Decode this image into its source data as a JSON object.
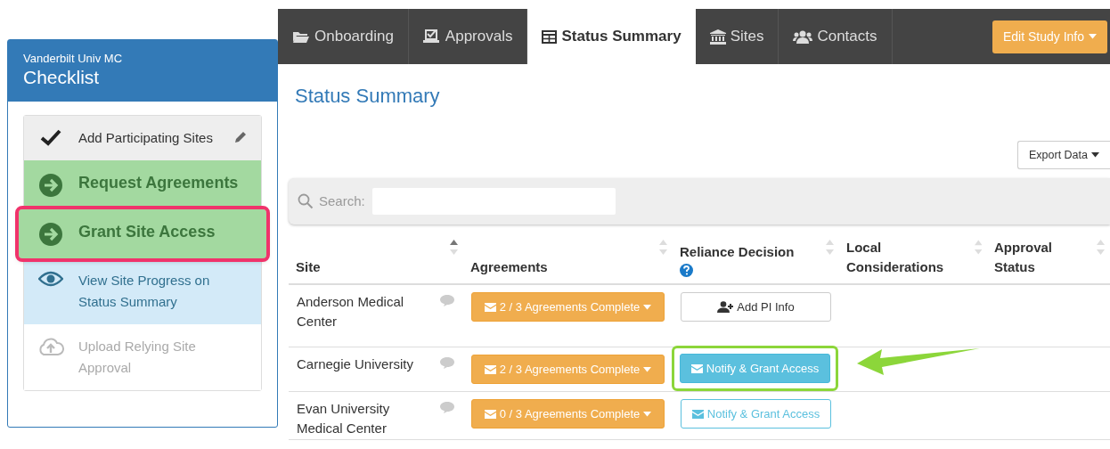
{
  "checklist": {
    "subtitle": "Vanderbilt Univ MC",
    "title": "Checklist",
    "items": [
      {
        "label": "Add Participating Sites",
        "kind": "done",
        "highlighted": false,
        "editable": true
      },
      {
        "label": "Request Agreements",
        "kind": "current",
        "highlighted": false,
        "editable": false
      },
      {
        "label": "Grant Site Access",
        "kind": "current",
        "highlighted": true,
        "editable": false
      },
      {
        "label": "View Site Progress on Status Summary",
        "kind": "view",
        "highlighted": false,
        "editable": false
      },
      {
        "label": "Upload Relying Site Approval",
        "kind": "pending",
        "highlighted": false,
        "editable": false
      }
    ]
  },
  "tabs": [
    {
      "label": "Onboarding",
      "selected": false
    },
    {
      "label": "Approvals",
      "selected": false
    },
    {
      "label": "Status Summary",
      "selected": true
    },
    {
      "label": "Sites",
      "selected": false
    },
    {
      "label": "Contacts",
      "selected": false
    }
  ],
  "edit_button": "Edit Study Info",
  "page_title": "Status Summary",
  "export_button": "Export Data",
  "search": {
    "label": "Search:"
  },
  "table": {
    "columns": [
      {
        "label": "Site",
        "sorted": true,
        "help": false
      },
      {
        "label": "Agreements",
        "sorted": false,
        "help": false
      },
      {
        "label": "Reliance Decision",
        "sorted": false,
        "help": true
      },
      {
        "label": "Local Considerations",
        "sorted": false,
        "help": false
      },
      {
        "label": "Approval Status",
        "sorted": false,
        "help": false
      }
    ],
    "rows": [
      {
        "site": "Anderson Medical Center",
        "agreements": "2 / 3 Agreements Complete",
        "action": {
          "kind": "add_pi",
          "label": "Add PI Info",
          "highlighted": false
        }
      },
      {
        "site": "Carnegie University",
        "agreements": "2 / 3 Agreements Complete",
        "action": {
          "kind": "notify_filled",
          "label": "Notify & Grant Access",
          "highlighted": true
        }
      },
      {
        "site": "Evan University Medical Center",
        "agreements": "0 / 3 Agreements Complete",
        "action": {
          "kind": "notify_outline",
          "label": "Notify & Grant Access",
          "highlighted": false
        }
      }
    ]
  }
}
